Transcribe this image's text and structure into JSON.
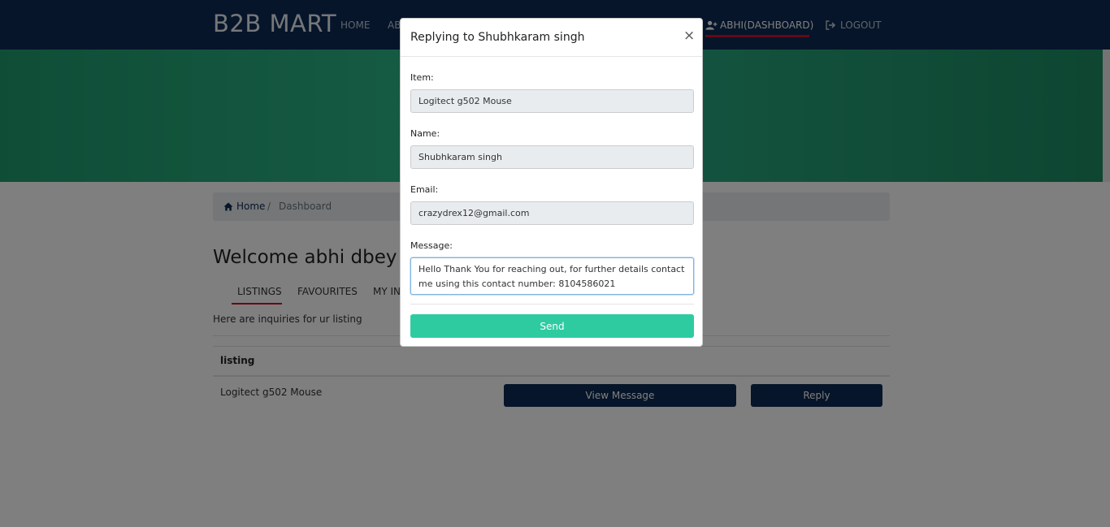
{
  "navbar": {
    "brand": "B2B MART",
    "links": {
      "home": "HOME",
      "about": "AB",
      "dashboard": "ABHI(DASHBOARD)",
      "logout": "LOGOUT"
    }
  },
  "breadcrumb": {
    "home": "Home",
    "separator": "/",
    "current": "Dashboard"
  },
  "page": {
    "welcome": "Welcome abhi dbey",
    "tabs": {
      "listings": "LISTINGS",
      "favourites": "FAVOURITES",
      "my_inquiries": "MY IN"
    },
    "inquiries_text": "Here are inquiries for ur listing",
    "table": {
      "header": "listing",
      "rows": [
        {
          "listing": "Logitect g502 Mouse",
          "view_label": "View Message",
          "reply_label": "Reply"
        }
      ]
    }
  },
  "modal": {
    "title": "Replying to Shubhkaram singh",
    "close": "×",
    "item_label": "Item:",
    "item_value": "Logitect g502 Mouse",
    "name_label": "Name:",
    "name_value": "Shubhkaram singh",
    "email_label": "Email:",
    "email_value": "crazydrex12@gmail.com",
    "message_label": "Message:",
    "message_value": "Hello Thank You for reaching out, for further details contact me using this contact number: 8104586021",
    "send_label": "Send"
  },
  "colors": {
    "navbar": "#0c2a52",
    "accent_red": "#d0102a",
    "hero_green": "#2bb486",
    "send_button": "#2ecba1",
    "dark_button": "#0c2a52"
  },
  "icons": {
    "add_user": "add-user-icon",
    "logout": "logout-icon",
    "home": "home-icon",
    "close": "close-icon"
  }
}
